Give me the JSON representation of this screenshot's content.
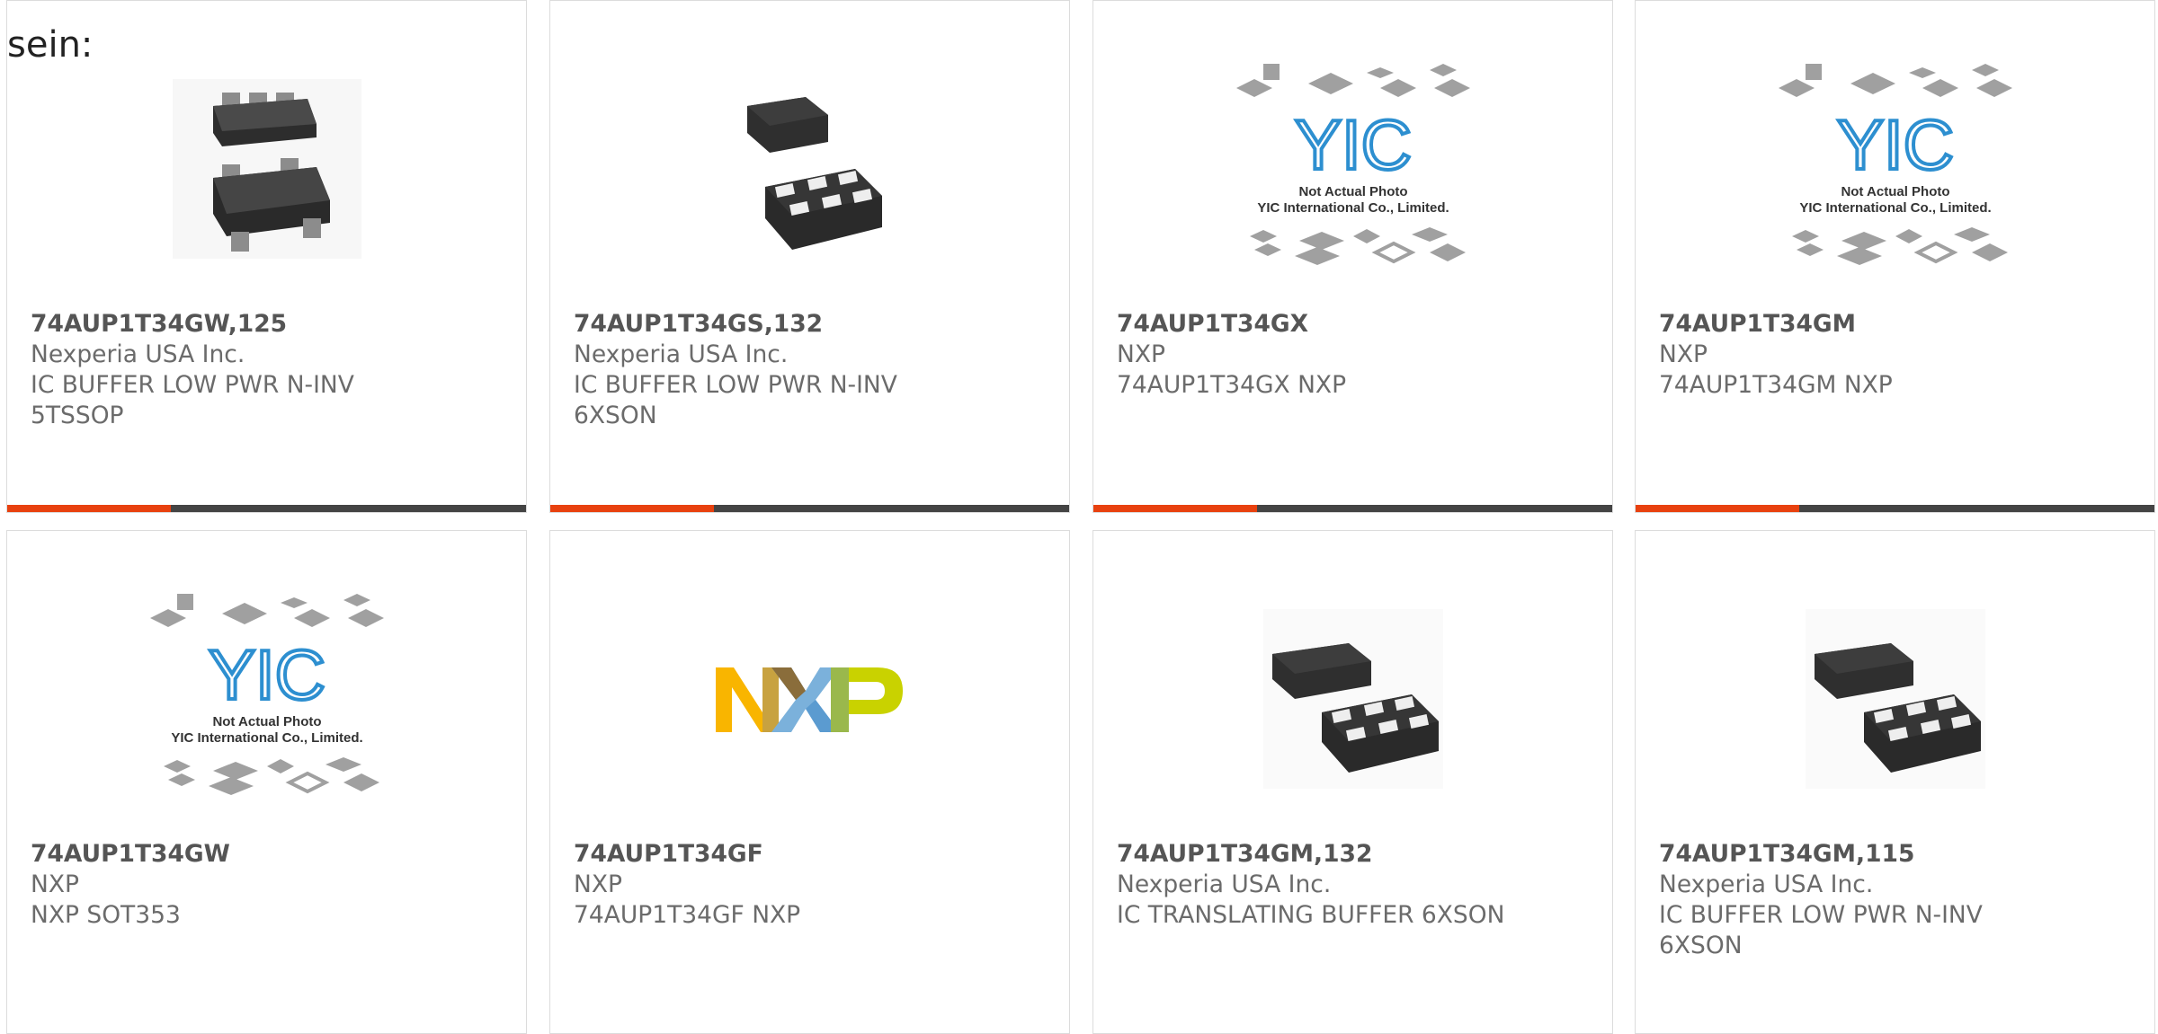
{
  "intro_text": "sein:",
  "colors": {
    "accent_bar": "#e8410f",
    "dark_bar": "#444444",
    "yic_blue": "#2d8fd0"
  },
  "products": [
    {
      "part": "74AUP1T34GW,125",
      "maker": "Nexperia USA Inc.",
      "desc": "IC BUFFER LOW PWR N-INV 5TSSOP",
      "image": "tssop5-package"
    },
    {
      "part": "74AUP1T34GS,132",
      "maker": "Nexperia USA Inc.",
      "desc": "IC BUFFER LOW PWR N-INV 6XSON",
      "image": "xson6-package"
    },
    {
      "part": "74AUP1T34GX",
      "maker": "NXP",
      "desc": "74AUP1T34GX NXP",
      "image": "yic-placeholder",
      "img_line1": "Not Actual Photo",
      "img_line2": "YIC International Co., Limited."
    },
    {
      "part": "74AUP1T34GM",
      "maker": "NXP",
      "desc": "74AUP1T34GM NXP",
      "image": "yic-placeholder",
      "img_line1": "Not Actual Photo",
      "img_line2": "YIC International Co., Limited."
    },
    {
      "part": "74AUP1T34GW",
      "maker": "NXP",
      "desc": "NXP SOT353",
      "image": "yic-placeholder",
      "img_line1": "Not Actual Photo",
      "img_line2": "YIC International Co., Limited."
    },
    {
      "part": "74AUP1T34GF",
      "maker": "NXP",
      "desc": "74AUP1T34GF NXP",
      "image": "nxp-logo"
    },
    {
      "part": "74AUP1T34GM,132",
      "maker": "Nexperia USA Inc.",
      "desc": "IC TRANSLATING BUFFER 6XSON",
      "image": "xson6-package"
    },
    {
      "part": "74AUP1T34GM,115",
      "maker": "Nexperia USA Inc.",
      "desc": "IC BUFFER LOW PWR N-INV 6XSON",
      "image": "xson6-package"
    }
  ]
}
